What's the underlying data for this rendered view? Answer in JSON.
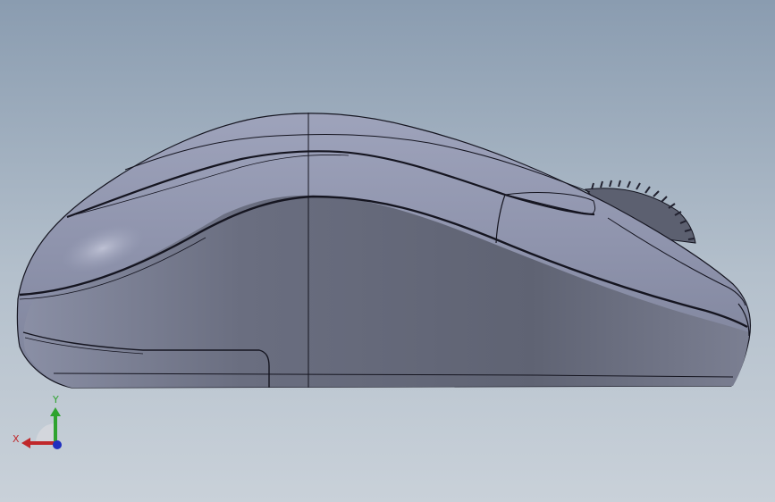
{
  "viewport": {
    "background_top": "#8a9cb0",
    "background_bottom": "#c9d1d9"
  },
  "model": {
    "name": "computer-mouse-side-view",
    "body_color": "#8f95ad",
    "shadow_color": "#5f6373",
    "edge_color": "#151520"
  },
  "triad": {
    "x_label": "X",
    "y_label": "Y",
    "x_color": "#c0282b",
    "y_color": "#2fa32f",
    "z_color": "#1f2fbf"
  }
}
